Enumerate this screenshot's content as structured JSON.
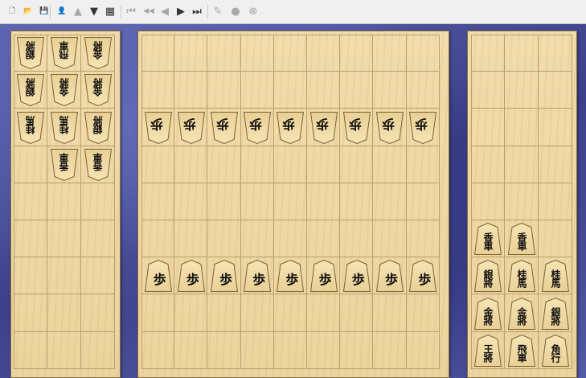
{
  "toolbar": {
    "buttons": [
      {
        "name": "new-file-button",
        "icon": "new-file-icon",
        "glyph": "🗋",
        "disabled": false
      },
      {
        "name": "open-file-button",
        "icon": "folder-open-icon",
        "glyph": "📂",
        "disabled": false
      },
      {
        "name": "save-button",
        "icon": "floppy-disk-icon",
        "glyph": "💾",
        "disabled": false
      },
      {
        "name": "player-button",
        "icon": "player-icon",
        "glyph": "👤",
        "disabled": false
      },
      {
        "name": "move-up-button",
        "icon": "triangle-up-icon",
        "glyph": "▲",
        "disabled": true
      },
      {
        "name": "move-down-button",
        "icon": "triangle-down-icon",
        "glyph": "▼",
        "disabled": false
      },
      {
        "name": "board-setup-button",
        "icon": "board-grid-icon",
        "glyph": "▦",
        "disabled": false
      },
      {
        "name": "first-move-button",
        "icon": "first-move-icon",
        "glyph": "⏮",
        "disabled": true
      },
      {
        "name": "fast-back-button",
        "icon": "fast-back-icon",
        "glyph": "◀◀",
        "disabled": true
      },
      {
        "name": "back-button",
        "icon": "back-icon",
        "glyph": "◀",
        "disabled": true
      },
      {
        "name": "forward-button",
        "icon": "forward-icon",
        "glyph": "▶",
        "disabled": false
      },
      {
        "name": "last-move-button",
        "icon": "last-move-icon",
        "glyph": "⏭",
        "disabled": false
      },
      {
        "name": "edit-button",
        "icon": "edit-icon",
        "glyph": "✎",
        "disabled": true
      },
      {
        "name": "record-button",
        "icon": "circle-icon",
        "glyph": "●",
        "disabled": true
      },
      {
        "name": "stop-button",
        "icon": "close-circle-icon",
        "glyph": "⊗",
        "disabled": true
      }
    ]
  },
  "colors": {
    "felt": "#4a4f9a",
    "board": "#ecd49e",
    "grid": "#b99f6c",
    "piece": "#f0dba6"
  },
  "left_stand": {
    "pieces": [
      {
        "row": 0,
        "col": 0,
        "text": "銀將"
      },
      {
        "row": 0,
        "col": 1,
        "text": "飛車"
      },
      {
        "row": 0,
        "col": 2,
        "text": "金將"
      },
      {
        "row": 1,
        "col": 0,
        "text": "銀將"
      },
      {
        "row": 1,
        "col": 1,
        "text": "金將"
      },
      {
        "row": 1,
        "col": 2,
        "text": "金將"
      },
      {
        "row": 2,
        "col": 0,
        "text": "桂馬"
      },
      {
        "row": 2,
        "col": 1,
        "text": "桂馬"
      },
      {
        "row": 2,
        "col": 2,
        "text": "銀將"
      },
      {
        "row": 3,
        "col": 1,
        "text": "香車"
      },
      {
        "row": 3,
        "col": 2,
        "text": "香車"
      }
    ]
  },
  "main_board": {
    "gote_pawn_row": 2,
    "sente_pawn_row": 6,
    "gote_pawns": [
      "歩",
      "歩",
      "歩",
      "歩",
      "歩",
      "歩",
      "歩",
      "歩",
      "歩"
    ],
    "sente_pawns": [
      "歩",
      "歩",
      "歩",
      "歩",
      "歩",
      "歩",
      "歩",
      "歩",
      "歩"
    ]
  },
  "right_stand": {
    "pieces": [
      {
        "row": 5,
        "col": 0,
        "text": "香車"
      },
      {
        "row": 5,
        "col": 1,
        "text": "香車"
      },
      {
        "row": 6,
        "col": 0,
        "text": "銀將"
      },
      {
        "row": 6,
        "col": 1,
        "text": "桂馬"
      },
      {
        "row": 6,
        "col": 2,
        "text": "桂馬"
      },
      {
        "row": 7,
        "col": 0,
        "text": "金將"
      },
      {
        "row": 7,
        "col": 1,
        "text": "金將"
      },
      {
        "row": 7,
        "col": 2,
        "text": "銀將"
      },
      {
        "row": 8,
        "col": 0,
        "text": "王將"
      },
      {
        "row": 8,
        "col": 1,
        "text": "飛車"
      },
      {
        "row": 8,
        "col": 2,
        "text": "角行"
      }
    ]
  }
}
